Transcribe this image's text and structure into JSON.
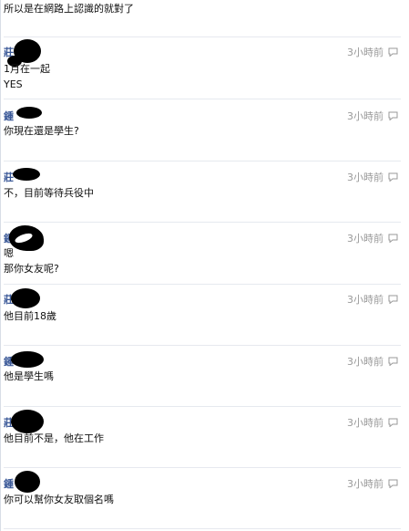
{
  "top_line": "所以是在網路上認識的就對了",
  "messages": [
    {
      "sender": "莊",
      "time": "3小時前",
      "lines": [
        "1月在一起",
        "YES"
      ]
    },
    {
      "sender": "鍾",
      "time": "3小時前",
      "lines": [
        "你現在還是學生?"
      ]
    },
    {
      "sender": "莊",
      "time": "3小時前",
      "lines": [
        "不，目前等待兵役中"
      ]
    },
    {
      "sender": "鍾",
      "time": "3小時前",
      "lines": [
        "嗯",
        "那你女友呢?"
      ]
    },
    {
      "sender": "莊",
      "time": "3小時前",
      "lines": [
        "他目前18歲"
      ]
    },
    {
      "sender": "鍾",
      "time": "3小時前",
      "lines": [
        "他是學生嗎"
      ]
    },
    {
      "sender": "莊",
      "time": "3小時前",
      "lines": [
        "他目前不是，他在工作"
      ]
    },
    {
      "sender": "鍾",
      "time": "3小時前",
      "lines": [
        "你可以幫你女友取個名嗎"
      ]
    }
  ]
}
